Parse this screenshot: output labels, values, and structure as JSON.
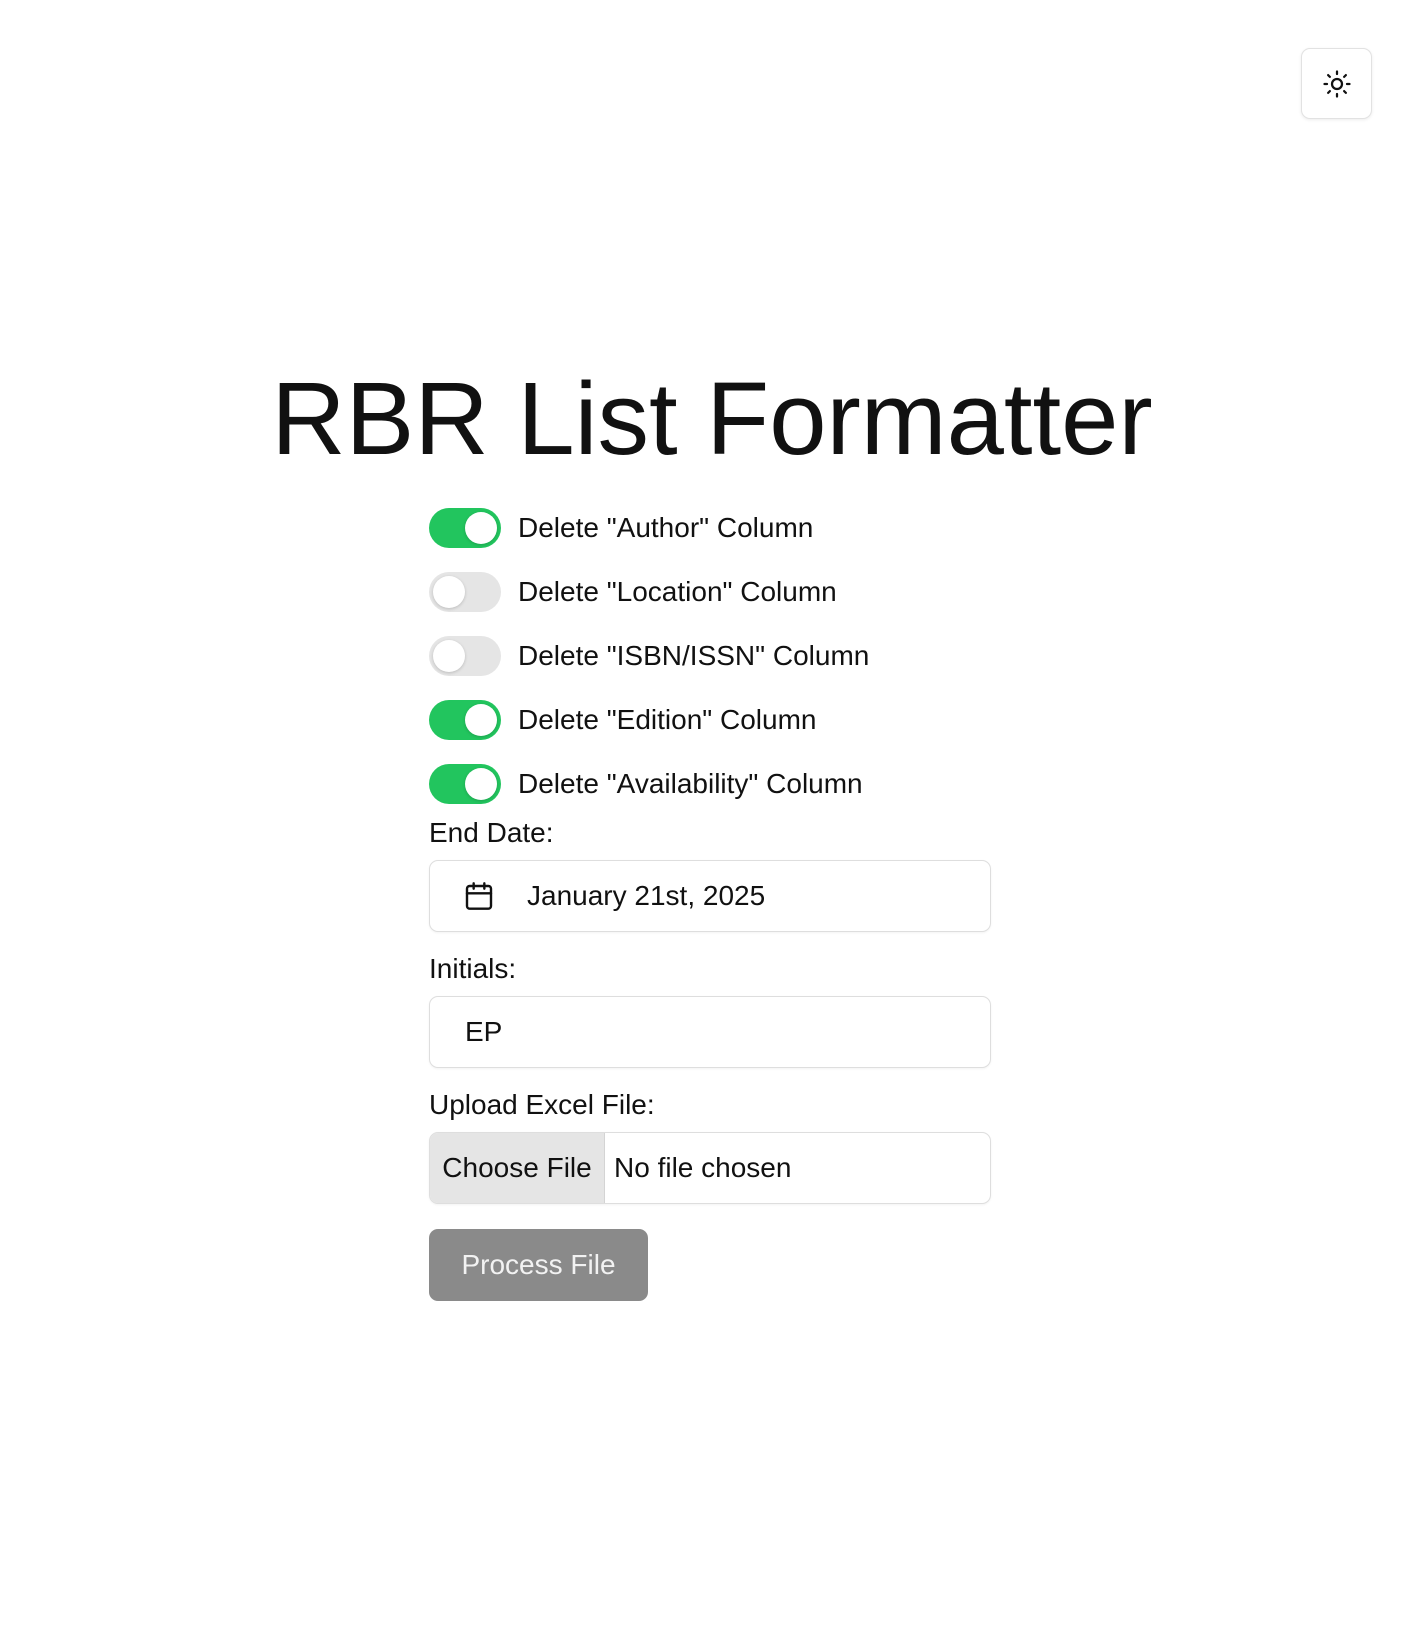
{
  "title": "RBR List Formatter",
  "theme_toggle": {
    "icon": "sun-icon"
  },
  "toggles": [
    {
      "label": "Delete \"Author\" Column",
      "checked": true
    },
    {
      "label": "Delete \"Location\" Column",
      "checked": false
    },
    {
      "label": "Delete \"ISBN/ISSN\" Column",
      "checked": false
    },
    {
      "label": "Delete \"Edition\" Column",
      "checked": true
    },
    {
      "label": "Delete \"Availability\" Column",
      "checked": true
    }
  ],
  "end_date": {
    "label": "End Date:",
    "value": "January 21st, 2025",
    "icon": "calendar-icon"
  },
  "initials": {
    "label": "Initials:",
    "value": "EP"
  },
  "upload": {
    "label": "Upload Excel File:",
    "button_label": "Choose File",
    "status": "No file chosen"
  },
  "process_button": "Process File",
  "colors": {
    "toggle_on": "#22c55e",
    "toggle_off": "#e5e5e5",
    "button_disabled": "#8a8a8a"
  }
}
